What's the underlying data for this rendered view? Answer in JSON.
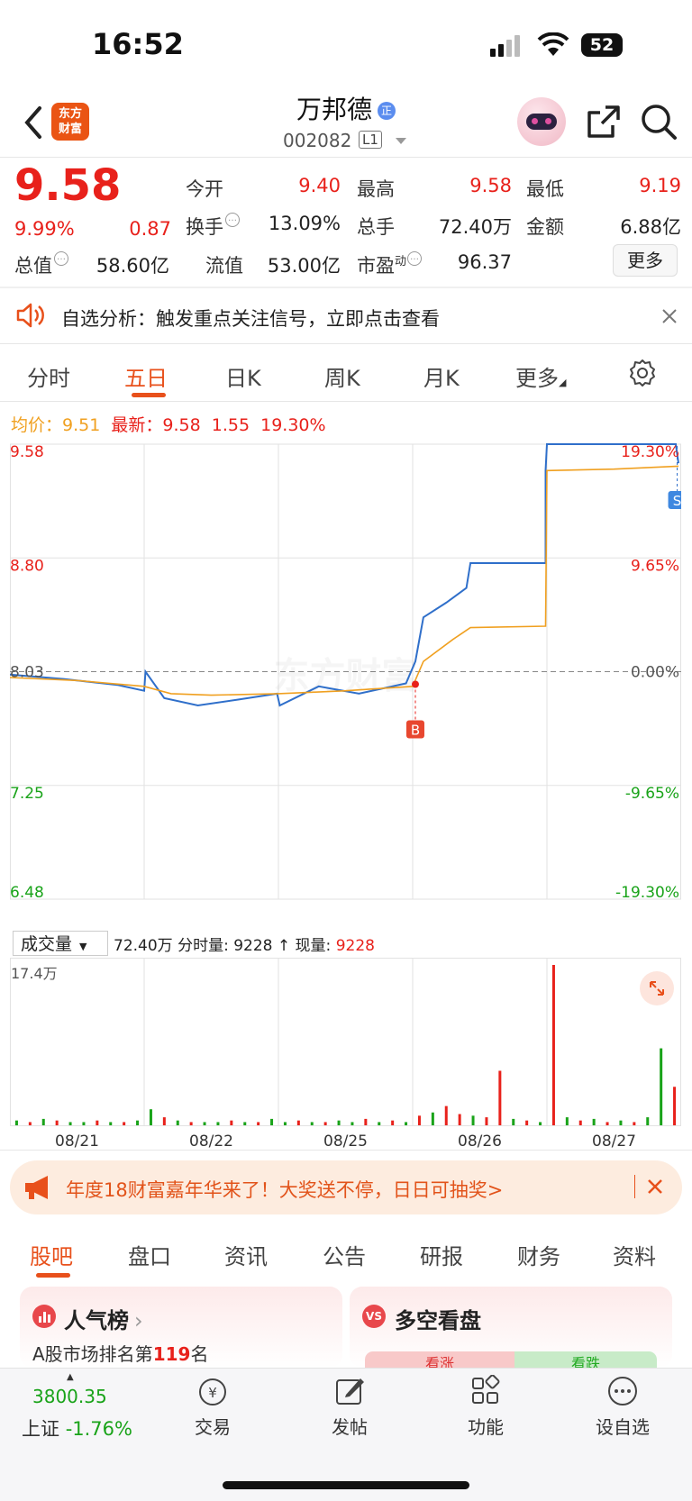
{
  "status_bar": {
    "time": "16:52",
    "battery": "52"
  },
  "header": {
    "logo_text": "东方财富",
    "stock_name": "万邦德",
    "stock_code": "002082",
    "level_badge": "L1"
  },
  "quote": {
    "price": "9.58",
    "change_pct": "9.99%",
    "change_amt": "0.87",
    "open_label": "今开",
    "open": "9.40",
    "high_label": "最高",
    "high": "9.58",
    "low_label": "最低",
    "low": "9.19",
    "turnover_label": "换手",
    "turnover": "13.09%",
    "volume_label": "总手",
    "volume": "72.40万",
    "amount_label": "金额",
    "amount": "6.88亿",
    "mktcap_label": "总值",
    "mktcap": "58.60亿",
    "float_label": "流值",
    "float_cap": "53.00亿",
    "pe_label": "市盈",
    "pe_sup": "动",
    "pe": "96.37",
    "more": "更多"
  },
  "notice": {
    "text": "自选分析：触发重点关注信号，立即点击查看"
  },
  "chart_tabs": [
    "分时",
    "五日",
    "日K",
    "周K",
    "月K",
    "更多"
  ],
  "active_chart_tab": 1,
  "chart_header": {
    "avg_label": "均价：",
    "avg": "9.51",
    "latest_label": "最新：",
    "latest": "9.58",
    "change": "1.55",
    "pct": "19.30%"
  },
  "volume_header": {
    "select": "成交量",
    "total": "72.40万",
    "tick_label": "分时量:",
    "tick": "9228",
    "now_label": "现量:",
    "now": "9228"
  },
  "chart_data": {
    "type": "line",
    "x_labels": [
      "08/21",
      "08/22",
      "08/25",
      "08/26",
      "08/27"
    ],
    "y_left_ticks": [
      "9.58",
      "8.80",
      "8.03",
      "7.25",
      "6.48"
    ],
    "y_right_ticks": [
      "19.30%",
      "9.65%",
      "0.00%",
      "-9.65%",
      "-19.30%"
    ],
    "ylim": [
      6.48,
      9.58
    ],
    "baseline": 8.03,
    "series": [
      {
        "name": "最新",
        "color": "#2f6fca",
        "x": [
          0,
          0.4,
          0.8,
          1.0,
          1.01,
          1.15,
          1.4,
          1.7,
          1.99,
          2.01,
          2.3,
          2.6,
          2.95,
          3.02,
          3.08,
          3.25,
          3.4,
          3.43,
          3.99,
          3.99,
          4.0,
          4.5,
          4.96,
          4.98
        ],
        "values": [
          8.01,
          7.98,
          7.94,
          7.9,
          8.03,
          7.85,
          7.8,
          7.84,
          7.88,
          7.8,
          7.93,
          7.88,
          7.95,
          8.1,
          8.4,
          8.5,
          8.6,
          8.77,
          8.77,
          9.4,
          9.58,
          9.58,
          9.58,
          9.45
        ]
      },
      {
        "name": "均价",
        "color": "#f0a020",
        "x": [
          0,
          0.5,
          1.0,
          1.2,
          1.5,
          2.0,
          2.5,
          3.0,
          3.08,
          3.3,
          3.43,
          3.99,
          4.0,
          4.5,
          4.98
        ],
        "values": [
          7.99,
          7.97,
          7.93,
          7.88,
          7.87,
          7.88,
          7.9,
          7.93,
          8.1,
          8.25,
          8.33,
          8.34,
          9.4,
          9.41,
          9.43
        ]
      }
    ],
    "markers": [
      {
        "label": "B",
        "x": 3.02
      },
      {
        "label": "S",
        "x": 4.97
      }
    ],
    "volume_max_label": "17.4万",
    "volume": [
      0.03,
      0.02,
      0.04,
      0.03,
      0.02,
      0.02,
      0.03,
      0.02,
      0.02,
      0.03,
      0.1,
      0.05,
      0.03,
      0.02,
      0.02,
      0.02,
      0.03,
      0.02,
      0.02,
      0.04,
      0.02,
      0.03,
      0.02,
      0.02,
      0.03,
      0.02,
      0.04,
      0.02,
      0.03,
      0.02,
      0.06,
      0.08,
      0.12,
      0.07,
      0.06,
      0.05,
      0.34,
      0.04,
      0.03,
      0.02,
      1.0,
      0.05,
      0.03,
      0.04,
      0.02,
      0.03,
      0.02,
      0.05,
      0.48,
      0.24
    ],
    "volume_colors": [
      "g",
      "r",
      "g",
      "r",
      "g",
      "g",
      "r",
      "g",
      "r",
      "g",
      "g",
      "r",
      "g",
      "r",
      "g",
      "g",
      "r",
      "g",
      "r",
      "g",
      "g",
      "r",
      "g",
      "r",
      "g",
      "g",
      "r",
      "g",
      "r",
      "g",
      "r",
      "g",
      "r",
      "r",
      "g",
      "r",
      "r",
      "g",
      "r",
      "g",
      "r",
      "g",
      "r",
      "g",
      "r",
      "g",
      "r",
      "g",
      "g",
      "r"
    ]
  },
  "promo": {
    "text": "年度18财富嘉年华来了！大奖送不停，日日可抽奖>"
  },
  "bottom_tabs": [
    "股吧",
    "盘口",
    "资讯",
    "公告",
    "研报",
    "财务",
    "资料"
  ],
  "active_bottom_tab": 0,
  "cards": {
    "rank_title": "人气榜",
    "rank_text": "A股市场排名第",
    "rank_num": "119",
    "rank_suffix": "名",
    "vs_title": "多空看盘",
    "bull": "看涨",
    "bear": "看跌"
  },
  "bottom_nav": {
    "index_value": "3800.35",
    "index_name": "上证",
    "index_pct": "-1.76%",
    "trade": "交易",
    "post": "发帖",
    "func": "功能",
    "watch": "设自选"
  }
}
